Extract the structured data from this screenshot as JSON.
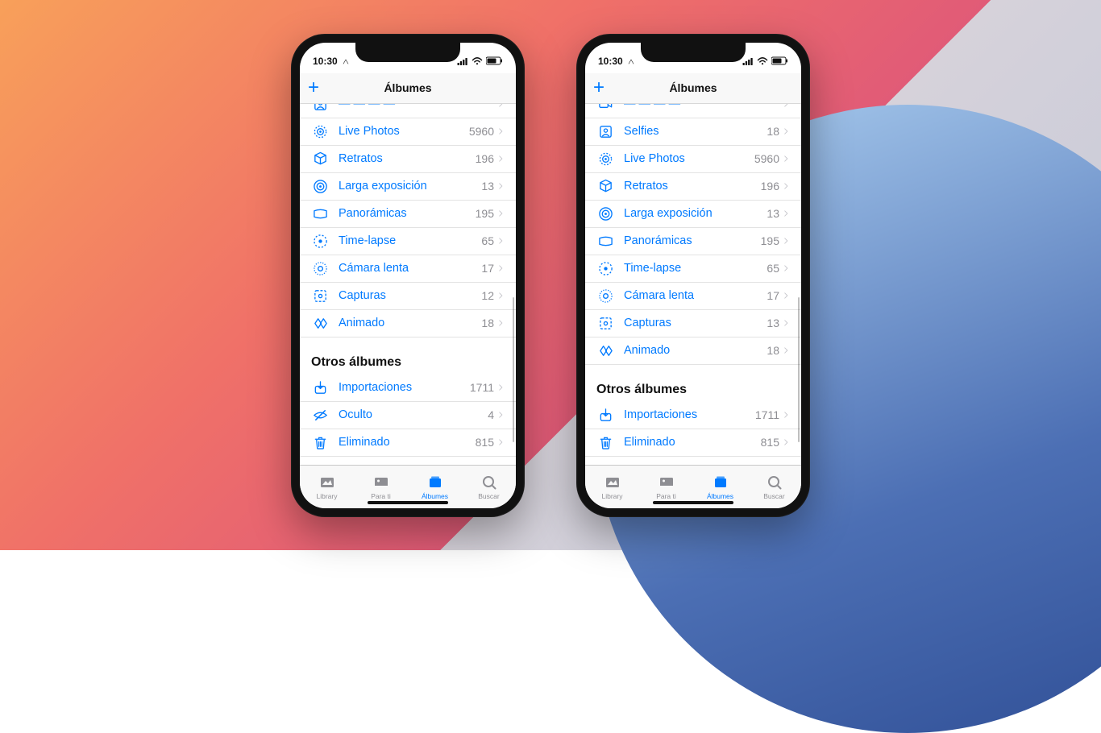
{
  "status": {
    "time": "10:30"
  },
  "nav": {
    "title": "Álbumes"
  },
  "section_other": "Otros álbumes",
  "tabs": {
    "library": "Library",
    "foryou": "Para ti",
    "albums": "Álbumes",
    "search": "Buscar"
  },
  "phoneA": {
    "rows": [
      {
        "icon": "selfie",
        "label": "— — — —",
        "count": ""
      },
      {
        "icon": "live",
        "label": "Live Photos",
        "count": "5960"
      },
      {
        "icon": "portrait",
        "label": "Retratos",
        "count": "196"
      },
      {
        "icon": "longexp",
        "label": "Larga exposición",
        "count": "13"
      },
      {
        "icon": "pano",
        "label": "Panorámicas",
        "count": "195"
      },
      {
        "icon": "timelapse",
        "label": "Time-lapse",
        "count": "65"
      },
      {
        "icon": "slowmo",
        "label": "Cámara lenta",
        "count": "17"
      },
      {
        "icon": "screenshot",
        "label": "Capturas",
        "count": "12"
      },
      {
        "icon": "animated",
        "label": "Animado",
        "count": "18"
      }
    ],
    "other": [
      {
        "icon": "import",
        "label": "Importaciones",
        "count": "1711"
      },
      {
        "icon": "hidden",
        "label": "Oculto",
        "count": "4"
      },
      {
        "icon": "trash",
        "label": "Eliminado",
        "count": "815"
      }
    ]
  },
  "phoneB": {
    "rows": [
      {
        "icon": "video",
        "label": "— — — —",
        "count": ""
      },
      {
        "icon": "selfie",
        "label": "Selfies",
        "count": "18"
      },
      {
        "icon": "live",
        "label": "Live Photos",
        "count": "5960"
      },
      {
        "icon": "portrait",
        "label": "Retratos",
        "count": "196"
      },
      {
        "icon": "longexp",
        "label": "Larga exposición",
        "count": "13"
      },
      {
        "icon": "pano",
        "label": "Panorámicas",
        "count": "195"
      },
      {
        "icon": "timelapse",
        "label": "Time-lapse",
        "count": "65"
      },
      {
        "icon": "slowmo",
        "label": "Cámara lenta",
        "count": "17"
      },
      {
        "icon": "screenshot",
        "label": "Capturas",
        "count": "13"
      },
      {
        "icon": "animated",
        "label": "Animado",
        "count": "18"
      }
    ],
    "other": [
      {
        "icon": "import",
        "label": "Importaciones",
        "count": "1711"
      },
      {
        "icon": "trash",
        "label": "Eliminado",
        "count": "815"
      }
    ]
  }
}
